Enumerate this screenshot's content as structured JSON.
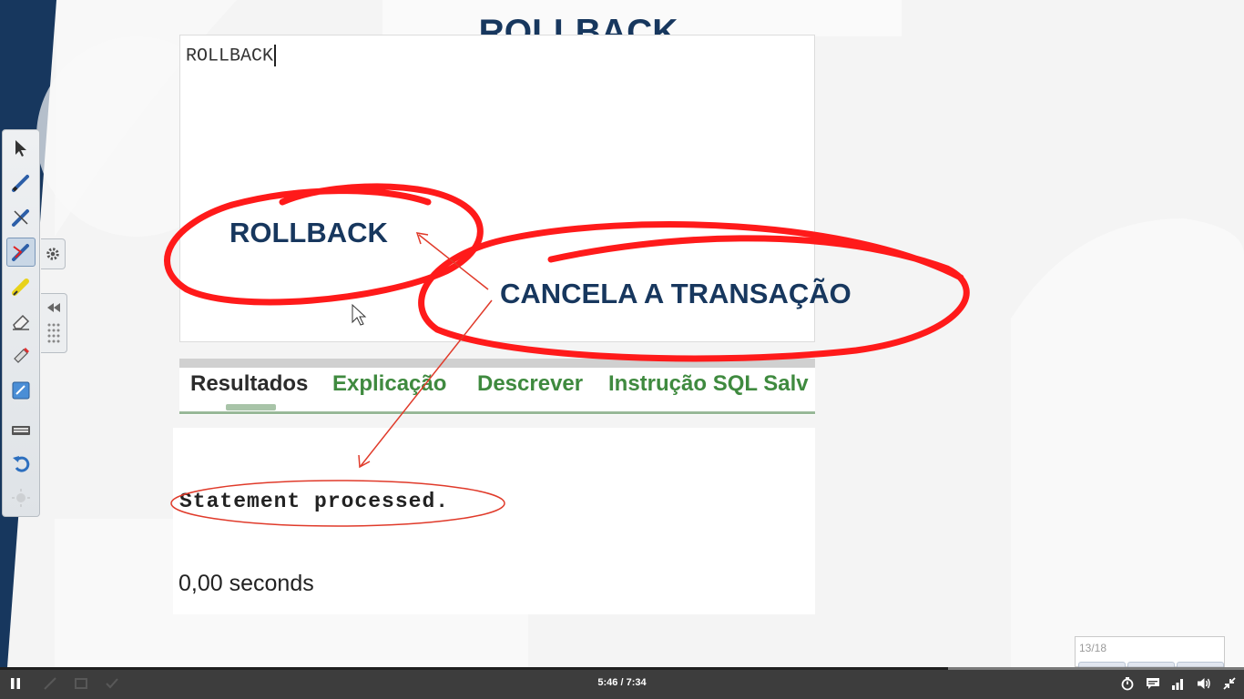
{
  "slide": {
    "title": "ROLLBACK",
    "editor_code": "ROLLBACK",
    "tabs": [
      {
        "label": "Resultados",
        "active": true
      },
      {
        "label": "Explicação",
        "active": false
      },
      {
        "label": "Descrever",
        "active": false
      },
      {
        "label": "Instrução SQL Salv",
        "active": false
      }
    ],
    "result_statement": "Statement processed.",
    "result_time": "0,00 seconds",
    "overlay_rollback": "ROLLBACK",
    "overlay_cancel": "CANCELA A TRANSAÇÃO"
  },
  "colors": {
    "title": "#17375e",
    "annotation_red": "#ff1a1a",
    "arrow_red": "#e03a2a",
    "tab_active": "#2b2b2b",
    "tab_inactive": "#3f8a3f",
    "player_bar": "#3d3d3d"
  },
  "pen_toolbar": {
    "tools": [
      {
        "name": "arrow-select-icon"
      },
      {
        "name": "pen-icon"
      },
      {
        "name": "pen-alt-icon"
      },
      {
        "name": "felt-pen-icon",
        "active": true
      },
      {
        "name": "highlighter-icon"
      },
      {
        "name": "eraser-icon"
      },
      {
        "name": "erase-all-icon"
      },
      {
        "name": "whiteboard-icon"
      },
      {
        "name": "keyboard-icon"
      },
      {
        "name": "undo-icon"
      },
      {
        "name": "laser-icon"
      }
    ]
  },
  "slide_counter": {
    "text": "13/18"
  },
  "player": {
    "time": "5:46 / 7:34",
    "progress": 0.762,
    "icons": [
      "pause-icon",
      "timer-icon",
      "captions-icon",
      "quality-icon",
      "volume-icon",
      "exit-fullscreen-icon"
    ]
  }
}
